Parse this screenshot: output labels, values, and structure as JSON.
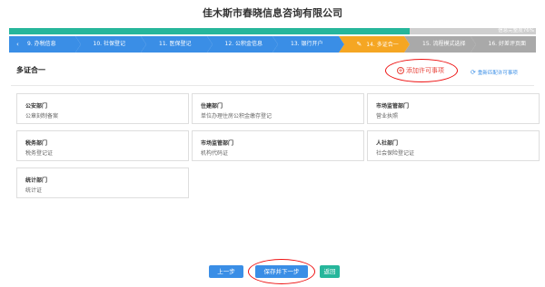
{
  "header": {
    "title": "佳木斯市春晓信息咨询有限公司"
  },
  "progress": {
    "percent": 76,
    "label": "信息完整度76%"
  },
  "steps": [
    {
      "label": "9. 办税信息",
      "state": "done"
    },
    {
      "label": "10. 社保登记",
      "state": "done"
    },
    {
      "label": "11. 医保登记",
      "state": "done"
    },
    {
      "label": "12. 公积金信息",
      "state": "done"
    },
    {
      "label": "13. 银行开户",
      "state": "done"
    },
    {
      "label": "14. 多证合一",
      "state": "active"
    },
    {
      "label": "15. 流程模式选择",
      "state": "todo"
    },
    {
      "label": "16. 好差评页面",
      "state": "todo"
    }
  ],
  "section": {
    "title": "多证合一",
    "add_label": "添加许可事项",
    "reconfig_label": "重新匹配许可事项"
  },
  "cards": [
    {
      "dept": "公安部门",
      "cert": "公章刻制备案"
    },
    {
      "dept": "住建部门",
      "cert": "单位办理住房公积金缴存登记"
    },
    {
      "dept": "市场监管部门",
      "cert": "营业执照"
    },
    {
      "dept": "税务部门",
      "cert": "税务登记证"
    },
    {
      "dept": "市场监管部门",
      "cert": "机构代码证"
    },
    {
      "dept": "人社部门",
      "cert": "社会保险登记证"
    },
    {
      "dept": "统计部门",
      "cert": "统计证"
    }
  ],
  "buttons": {
    "prev": "上一步",
    "save_next": "保存并下一步",
    "back": "返回"
  },
  "colors": {
    "primary": "#3a8ee6",
    "active_step": "#f5a623",
    "todo_step": "#a9a9a9",
    "progress": "#26b69b",
    "highlight": "#e8453c"
  }
}
